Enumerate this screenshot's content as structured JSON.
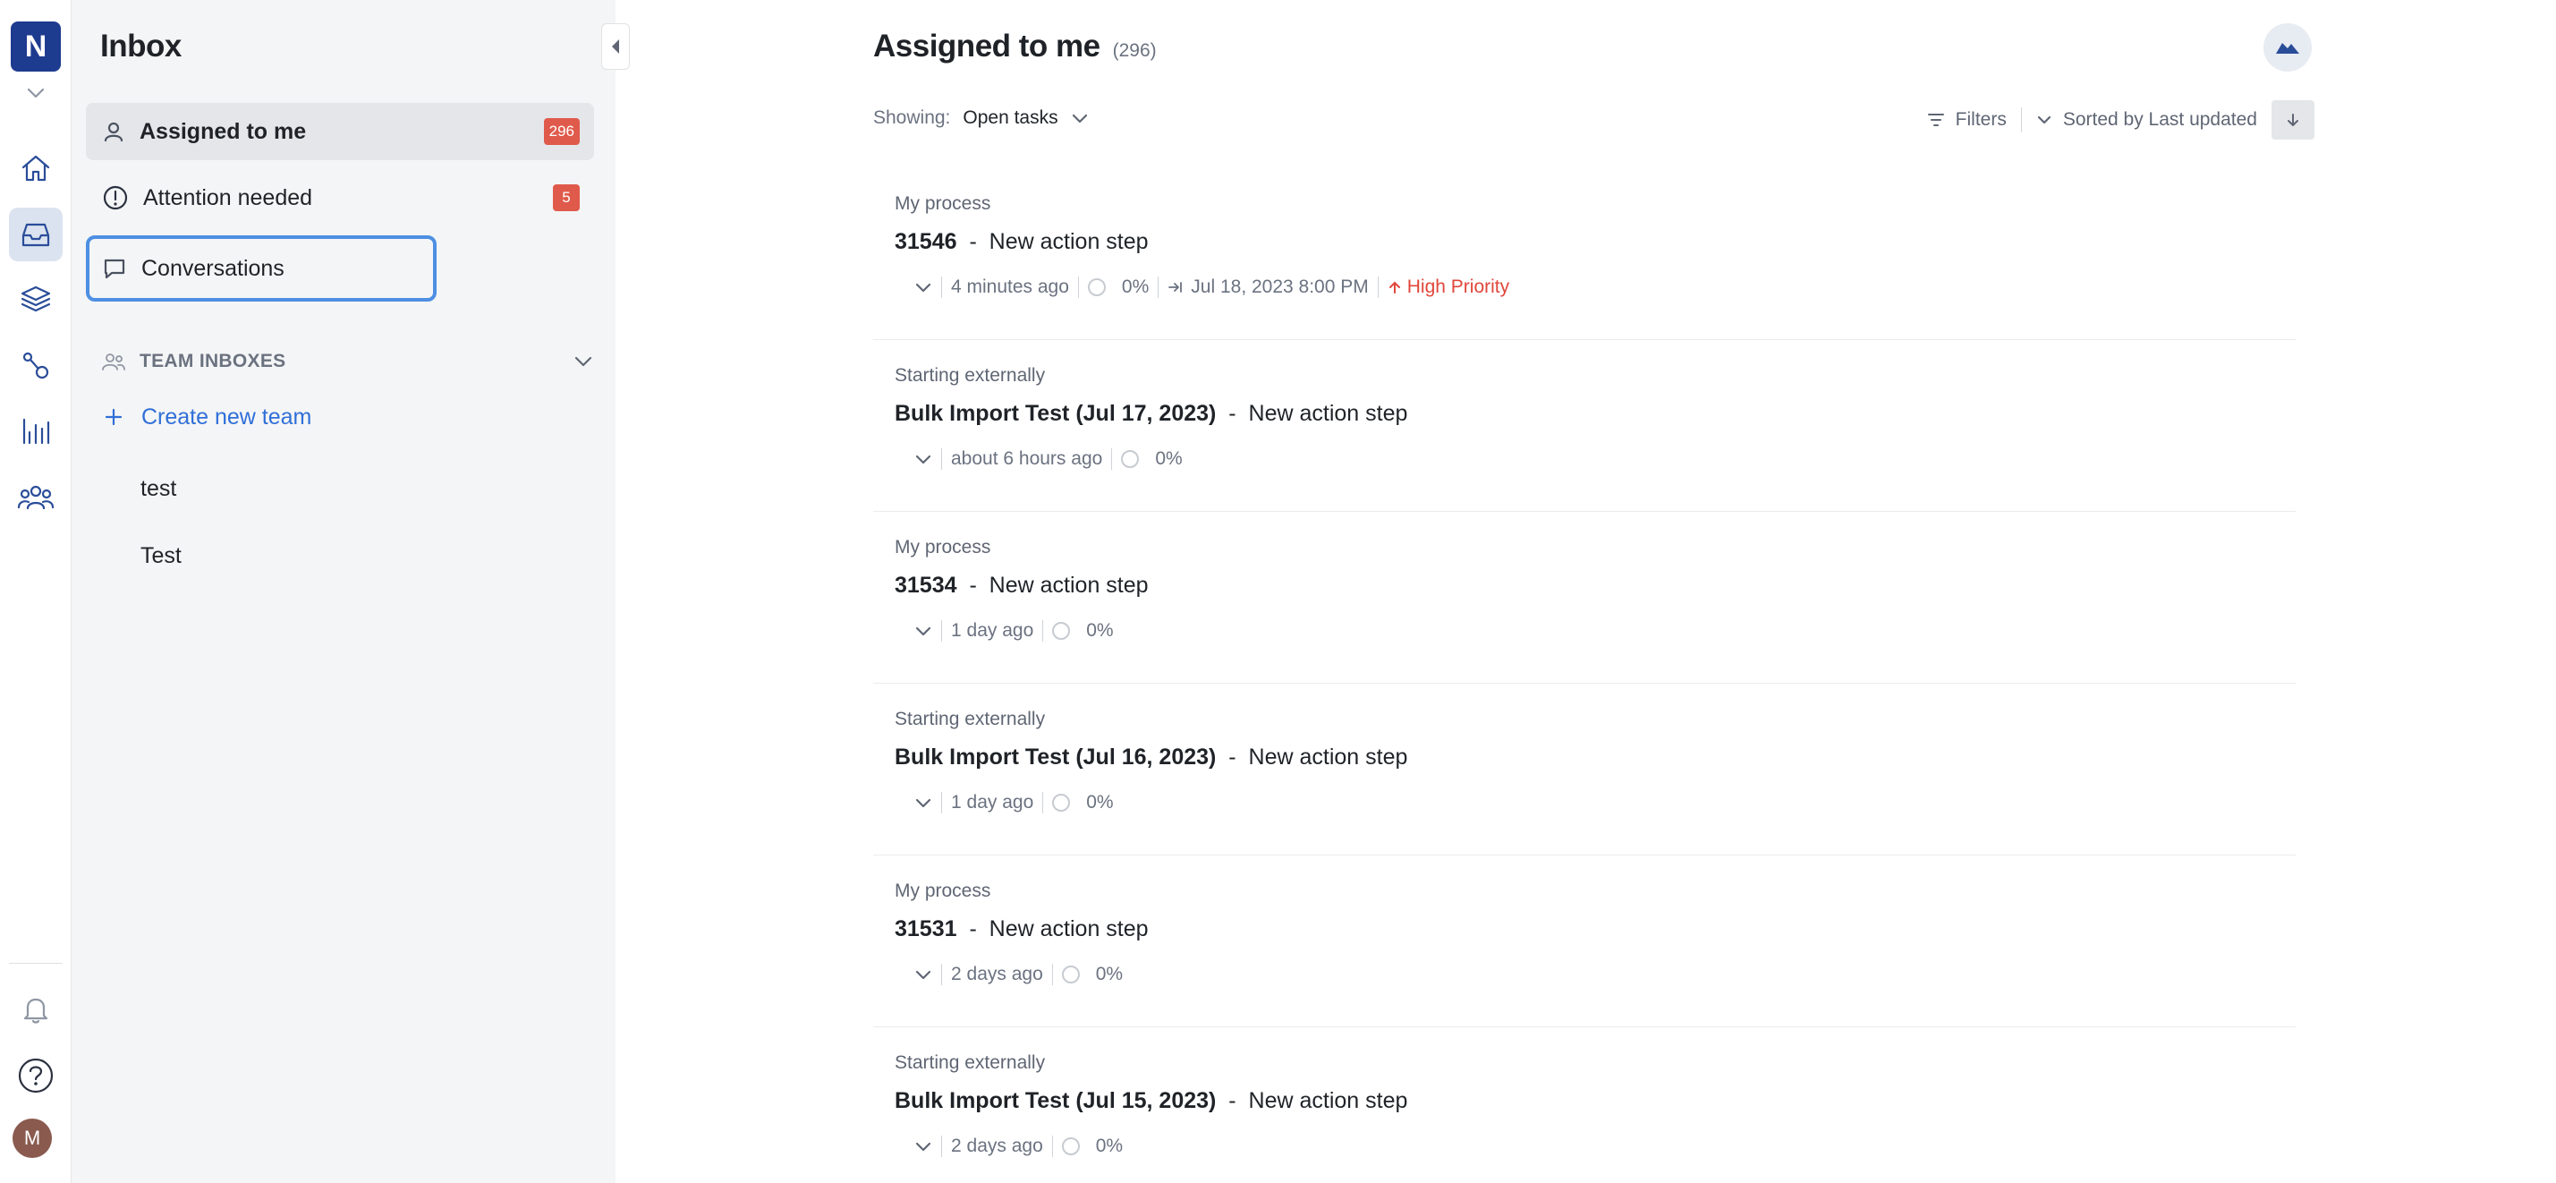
{
  "rail": {
    "logo_letter": "N",
    "avatar_letter": "M",
    "icons": [
      "home-icon",
      "inbox-icon",
      "layers-icon",
      "process-icon",
      "bar-chart-icon",
      "team-icon",
      "bell-icon",
      "help-icon"
    ]
  },
  "panel": {
    "title": "Inbox",
    "items": [
      {
        "label": "Assigned to me",
        "badge": "296",
        "icon": "user-icon",
        "active": true
      },
      {
        "label": "Attention needed",
        "badge": "5",
        "icon": "alert-icon"
      },
      {
        "label": "Conversations",
        "icon": "chat-icon",
        "focused": true
      }
    ],
    "section_label": "TEAM INBOXES",
    "create_team_label": "Create new team",
    "teams": [
      "test",
      "Test"
    ]
  },
  "main": {
    "title": "Assigned to me",
    "count": "(296)",
    "showing_label": "Showing:",
    "showing_value": "Open tasks",
    "filters_label": "Filters",
    "sort_label": "Sorted by Last updated",
    "tasks": [
      {
        "process": "My process",
        "id": "31546",
        "sep": "-",
        "step": "New action step",
        "time": "4 minutes ago",
        "progress": "0%",
        "due": "Jul 18, 2023 8:00 PM",
        "priority": "High Priority"
      },
      {
        "process": "Starting externally",
        "id": "Bulk Import Test (Jul 17, 2023)",
        "sep": "-",
        "step": "New action step",
        "time": "about 6 hours ago",
        "progress": "0%"
      },
      {
        "process": "My process",
        "id": "31534",
        "sep": "-",
        "step": "New action step",
        "time": "1 day ago",
        "progress": "0%"
      },
      {
        "process": "Starting externally",
        "id": "Bulk Import Test (Jul 16, 2023)",
        "sep": "-",
        "step": "New action step",
        "time": "1 day ago",
        "progress": "0%"
      },
      {
        "process": "My process",
        "id": "31531",
        "sep": "-",
        "step": "New action step",
        "time": "2 days ago",
        "progress": "0%"
      },
      {
        "process": "Starting externally",
        "id": "Bulk Import Test (Jul 15, 2023)",
        "sep": "-",
        "step": "New action step",
        "time": "2 days ago",
        "progress": "0%"
      }
    ]
  }
}
